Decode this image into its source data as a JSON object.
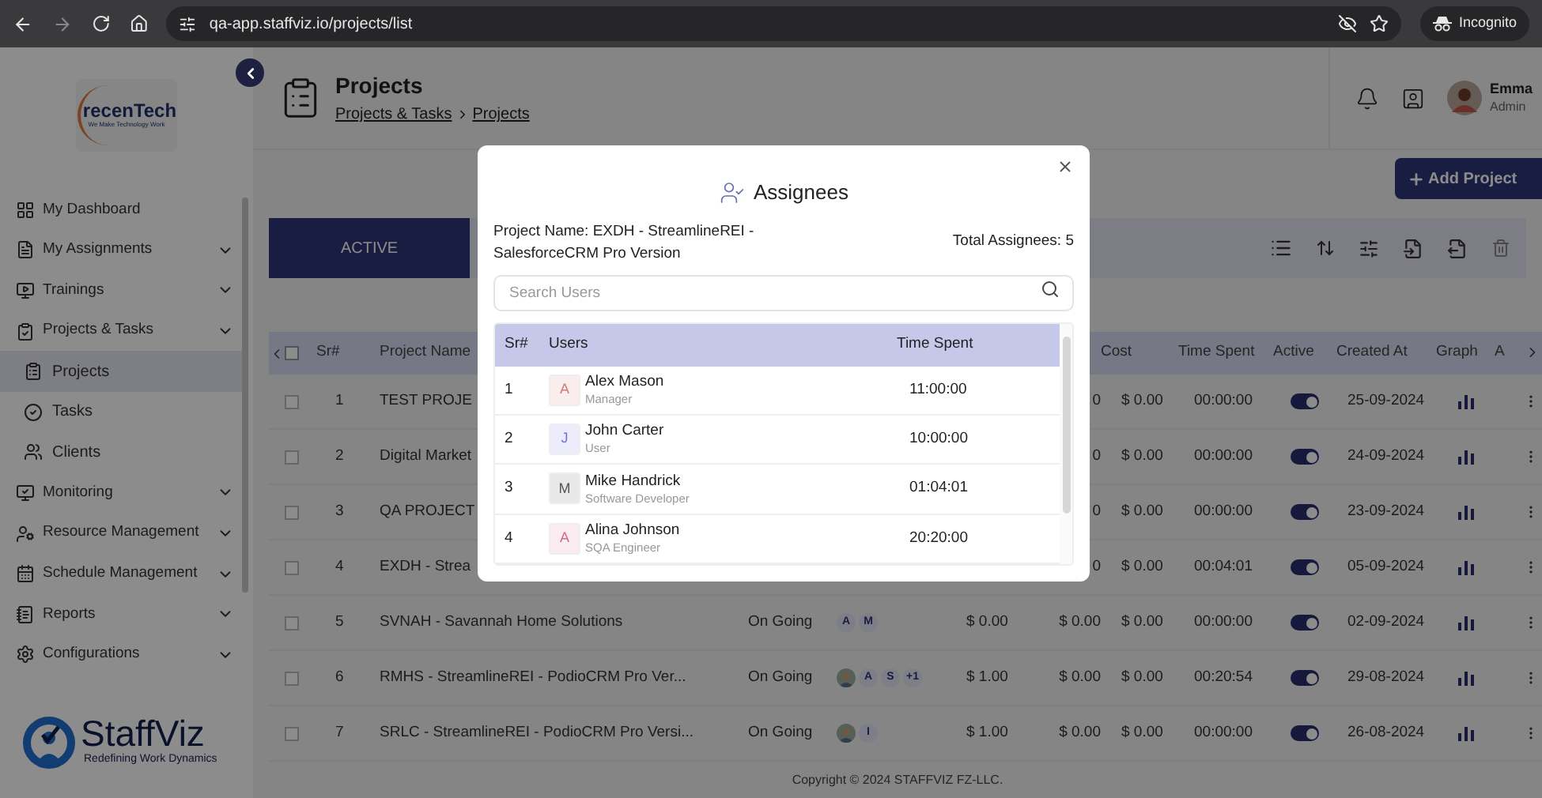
{
  "browser": {
    "url": "qa-app.staffviz.io/projects/list",
    "profile": "Incognito"
  },
  "sidebar": {
    "logo": {
      "name": "recenTech",
      "tagline": "We Make Technology Work"
    },
    "items": [
      {
        "label": "My Dashboard",
        "submenu": false,
        "selected": false
      },
      {
        "label": "My Assignments",
        "submenu": true,
        "selected": false
      },
      {
        "label": "Trainings",
        "submenu": true,
        "selected": false
      },
      {
        "label": "Projects & Tasks",
        "submenu": true,
        "selected": false,
        "children": [
          {
            "label": "Projects",
            "selected": true
          },
          {
            "label": "Tasks",
            "selected": false
          },
          {
            "label": "Clients",
            "selected": false
          }
        ]
      },
      {
        "label": "Monitoring",
        "submenu": true,
        "selected": false
      },
      {
        "label": "Resource Management",
        "submenu": true,
        "selected": false
      },
      {
        "label": "Schedule Management",
        "submenu": true,
        "selected": false
      },
      {
        "label": "Reports",
        "submenu": true,
        "selected": false
      },
      {
        "label": "Configurations",
        "submenu": true,
        "selected": false
      }
    ],
    "footer_logo": {
      "name": "StaffViz",
      "tagline": "Redefining Work Dynamics"
    }
  },
  "header": {
    "title": "Projects",
    "breadcrumb": [
      "Projects & Tasks",
      "Projects"
    ],
    "user": {
      "name": "Emma",
      "role": "Admin"
    }
  },
  "add_button": "Add Project",
  "tabs": [
    {
      "label": "ACTIVE",
      "selected": true
    }
  ],
  "table": {
    "select_all": false,
    "columns": [
      "Sr#",
      "Project Name",
      "Cost",
      "Time Spent",
      "Active",
      "Created At",
      "Graph",
      "A"
    ],
    "rows": [
      {
        "checked": false,
        "sr": "1",
        "name": "TEST PROJE",
        "column_6": "0",
        "cost": "$ 0.00",
        "time_spent": "00:00:00",
        "active": true,
        "created_at": "25-09-2024"
      },
      {
        "checked": false,
        "sr": "2",
        "name": "Digital Market",
        "column_6": "0",
        "cost": "$ 0.00",
        "time_spent": "00:00:00",
        "active": true,
        "created_at": "24-09-2024"
      },
      {
        "checked": false,
        "sr": "3",
        "name": "QA PROJECT",
        "column_6": "0",
        "cost": "$ 0.00",
        "time_spent": "00:00:00",
        "active": true,
        "created_at": "23-09-2024"
      },
      {
        "checked": false,
        "sr": "4",
        "name": "EXDH - Strea",
        "column_6": "0",
        "cost": "$ 0.00",
        "time_spent": "00:04:01",
        "active": true,
        "created_at": "05-09-2024"
      },
      {
        "checked": false,
        "sr": "5",
        "name": "SVNAH - Savannah Home Solutions",
        "column_3": "On Going",
        "column_4": [
          {
            "kind": "letter",
            "text": "A"
          },
          {
            "kind": "letter",
            "text": "M"
          }
        ],
        "column_5": "$ 0.00",
        "column_6": "$ 0.00",
        "cost": "$ 0.00",
        "time_spent": "00:00:00",
        "active": true,
        "created_at": "02-09-2024"
      },
      {
        "checked": false,
        "sr": "6",
        "name": "RMHS - StreamlineREI - PodioCRM Pro Ver...",
        "column_3": "On Going",
        "column_4": [
          {
            "kind": "picture"
          },
          {
            "kind": "letter",
            "text": "A"
          },
          {
            "kind": "letter",
            "text": "S"
          },
          {
            "kind": "letter",
            "text": "+1"
          }
        ],
        "column_5": "$ 1.00",
        "column_6": "$ 0.00",
        "cost": "$ 0.00",
        "time_spent": "00:20:54",
        "active": true,
        "created_at": "29-08-2024"
      },
      {
        "checked": false,
        "sr": "7",
        "name": "SRLC - StreamlineREI - PodioCRM Pro Versi...",
        "column_3": "On Going",
        "column_4": [
          {
            "kind": "picture"
          },
          {
            "kind": "letter",
            "text": "I"
          }
        ],
        "column_5": "$ 1.00",
        "column_6": "$ 0.00",
        "cost": "$ 0.00",
        "time_spent": "00:00:00",
        "active": true,
        "created_at": "26-08-2024"
      }
    ]
  },
  "footer": "Copyright © 2024 STAFFVIZ FZ-LLC.",
  "modal": {
    "title": "Assignees",
    "project_name": "Project Name: EXDH - StreamlineREI - SalesforceCRM Pro Version",
    "total": "Total Assignees: 5",
    "search": {
      "placeholder": "Search Users"
    },
    "columns": [
      "Sr#",
      "Users",
      "Time Spent"
    ],
    "rows": [
      {
        "sr": "1",
        "initial": "A",
        "color": "#d27b7b",
        "name": "Alex Mason",
        "role": "Manager",
        "time_spent": "11:00:00"
      },
      {
        "sr": "2",
        "initial": "J",
        "color": "#7b6fd6",
        "name": "John Carter",
        "role": "User",
        "time_spent": "10:00:00"
      },
      {
        "sr": "3",
        "initial": "M",
        "color": "#555555",
        "name": "Mike Handrick",
        "role": "Software Developer",
        "time_spent": "01:04:01"
      },
      {
        "sr": "4",
        "initial": "A",
        "color": "#d06b8f",
        "name": "Alina Johnson",
        "role": "SQA Engineer",
        "time_spent": "20:20:00"
      }
    ]
  }
}
